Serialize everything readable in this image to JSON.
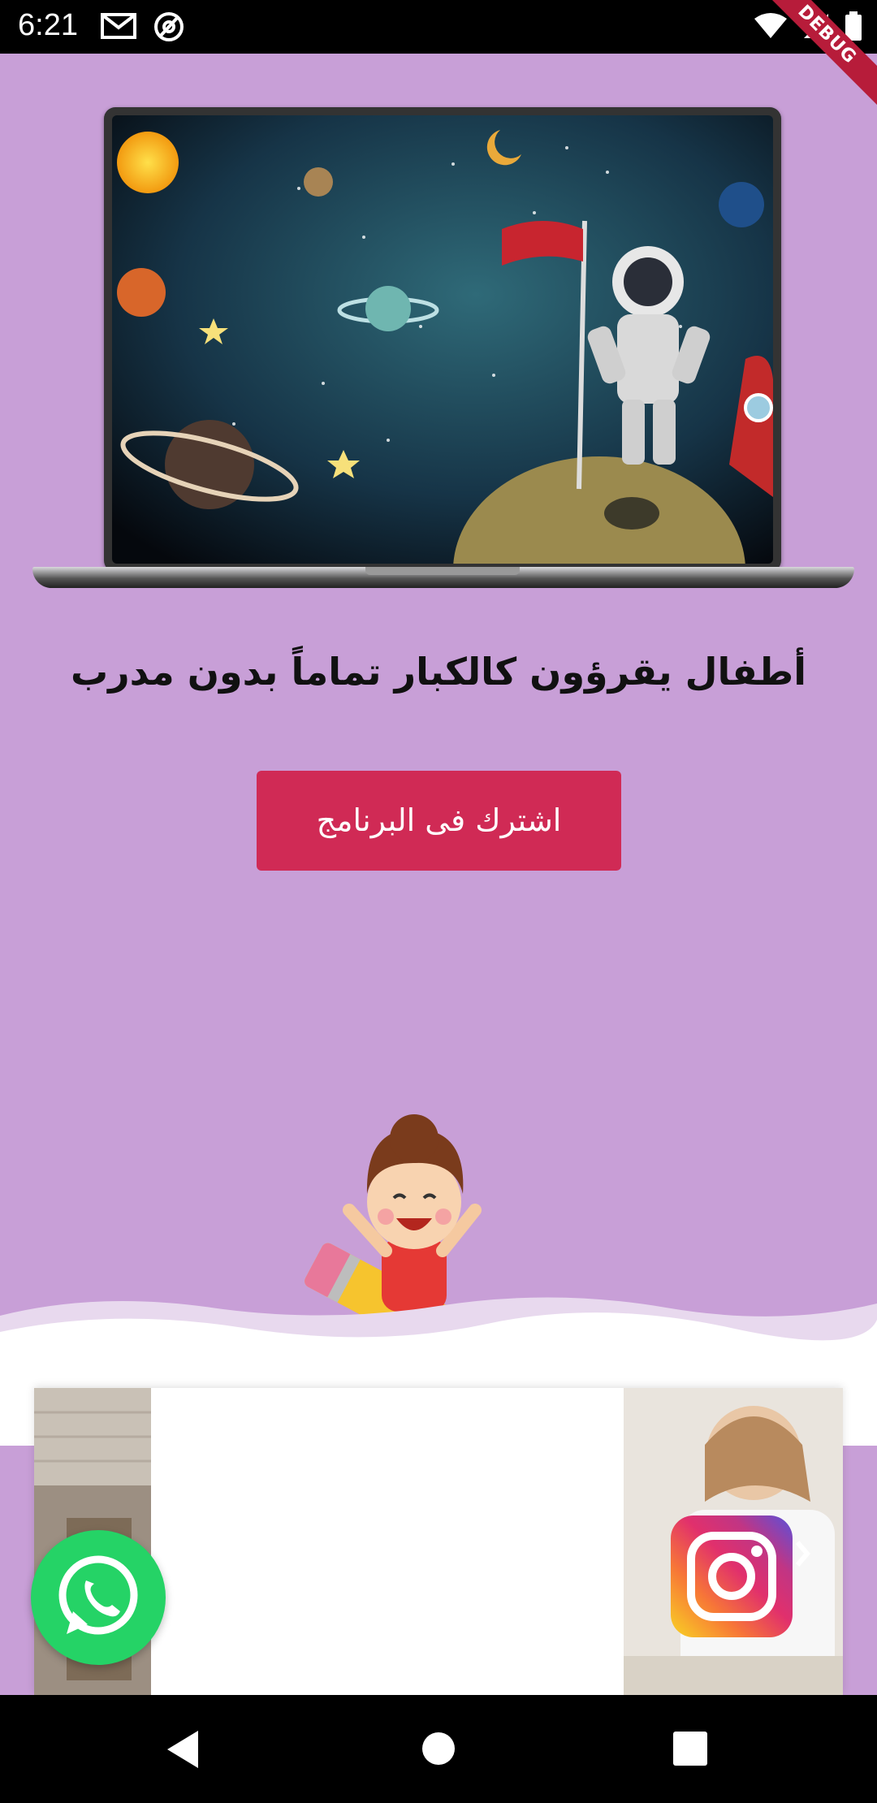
{
  "status_bar": {
    "time": "6:21",
    "left_icons": [
      "gmail-icon",
      "at-sign-icon"
    ],
    "right_icons": [
      "wifi-icon",
      "signal-icon",
      "battery-icon"
    ],
    "debug_banner": "DEBUG"
  },
  "hero": {
    "image": "laptop-space-astronaut-illustration"
  },
  "headline": "أطفال يقرؤون كالكبار تماماً بدون مدرب",
  "cta_button": {
    "label": "اشترك فى البرنامج",
    "color": "#d02a55"
  },
  "theme": {
    "background": "#c89fd7"
  },
  "floating_buttons": {
    "whatsapp": "whatsapp-icon",
    "instagram": "instagram-icon"
  },
  "nav_bar": [
    "back-icon",
    "home-icon",
    "recents-icon"
  ]
}
